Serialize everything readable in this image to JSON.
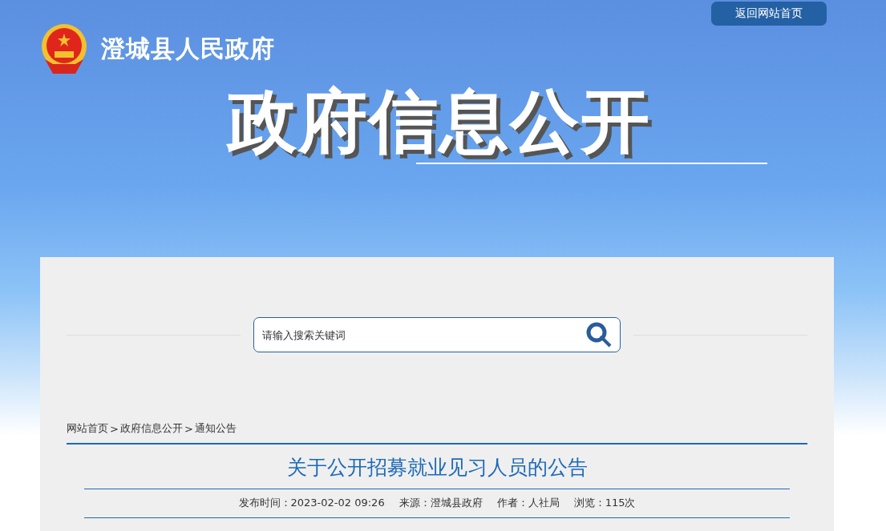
{
  "header": {
    "site_name": "澄城县人民政府",
    "home_button": "返回网站首页",
    "banner_title": "政府信息公开"
  },
  "search": {
    "placeholder": "请输入搜索关键词"
  },
  "breadcrumb": {
    "separator": ">",
    "items": [
      "网站首页",
      "政府信息公开",
      "通知公告"
    ]
  },
  "article": {
    "title": "关于公开招募就业见习人员的公告",
    "meta": [
      {
        "label": "发布时间：",
        "value": "2023-02-02 09:26"
      },
      {
        "label": "来源：",
        "value": "澄城县政府"
      },
      {
        "label": "作者：",
        "value": "人社局"
      },
      {
        "label": "浏览：",
        "value": "115次"
      }
    ]
  }
}
